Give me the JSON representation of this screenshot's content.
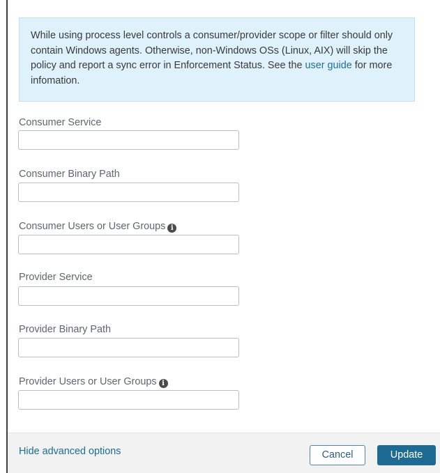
{
  "info_banner": {
    "text_before_link": "While using process level controls a consumer/provider scope or filter should only contain Windows agents. Otherwise, non-Windows OSs (Linux, AIX) will skip the policy and report a sync error in Enforcement Status. See the ",
    "link_label": "user guide",
    "text_after_link": " for more infomation."
  },
  "fields": {
    "consumer_service": {
      "label": "Consumer Service",
      "value": ""
    },
    "consumer_binary_path": {
      "label": "Consumer Binary Path",
      "value": ""
    },
    "consumer_users": {
      "label": "Consumer Users or User Groups",
      "value": ""
    },
    "provider_service": {
      "label": "Provider Service",
      "value": ""
    },
    "provider_binary_path": {
      "label": "Provider Binary Path",
      "value": ""
    },
    "provider_users": {
      "label": "Provider Users or User Groups",
      "value": ""
    }
  },
  "icons": {
    "info_icon_glyph": "i",
    "info_icon_name": "info-icon"
  },
  "footer": {
    "hide_advanced_label": "Hide advanced options",
    "cancel_label": "Cancel",
    "update_label": "Update"
  },
  "colors": {
    "banner_background": "#dff2fc",
    "link": "#1e6b8e",
    "primary_button": "#1f6a93"
  }
}
